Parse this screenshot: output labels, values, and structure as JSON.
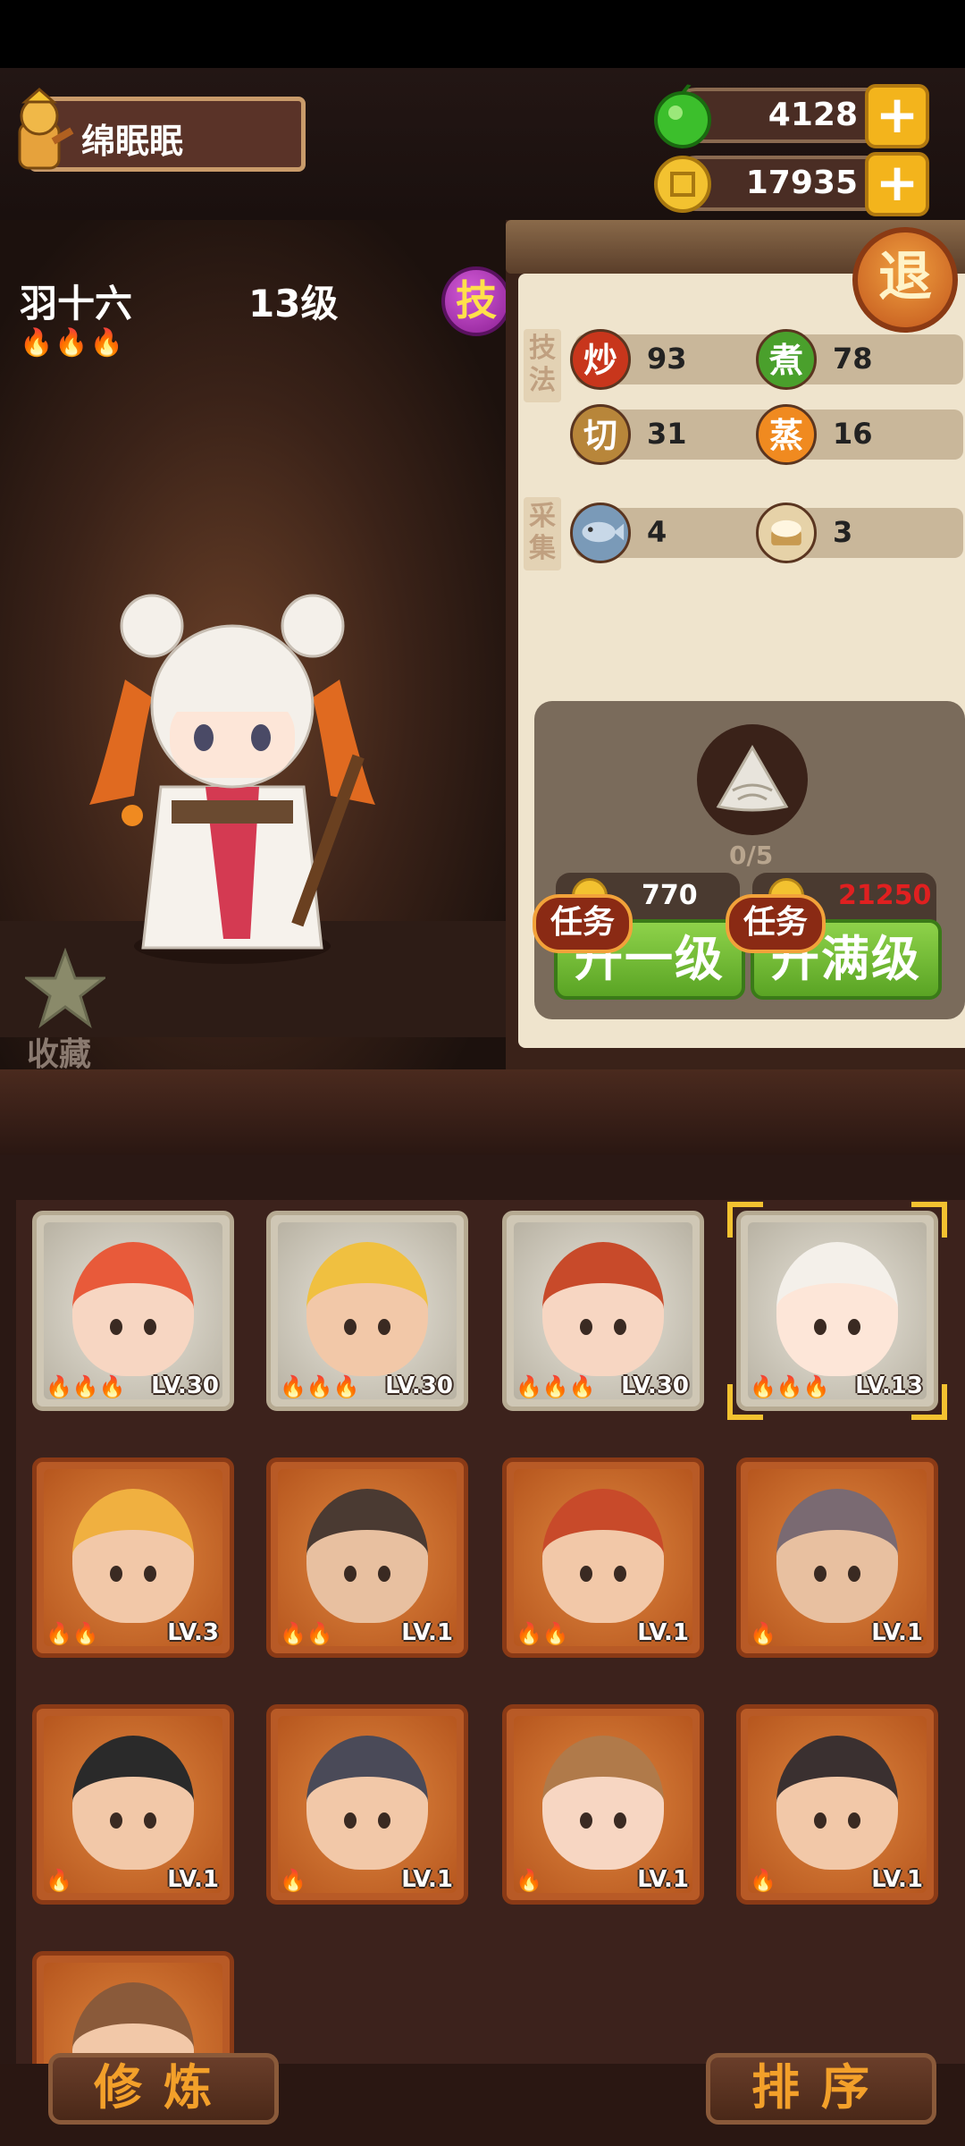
{
  "player": {
    "name": "绵眠眠"
  },
  "resources": {
    "jade": "4128",
    "coins": "17935"
  },
  "character": {
    "name": "羽十六",
    "level": "13级",
    "flames": "🔥🔥🔥",
    "skill_button": "技",
    "favorite_label": "收藏"
  },
  "exit_button": "退",
  "stats": {
    "technique_tag": "技法",
    "gather_tag": "采集",
    "stir_fry": {
      "label": "炒",
      "value": "93"
    },
    "boil": {
      "label": "煮",
      "value": "78"
    },
    "cut": {
      "label": "切",
      "value": "31"
    },
    "steam": {
      "label": "蒸",
      "value": "16"
    },
    "fish": {
      "value": "4"
    },
    "bun": {
      "value": "3"
    }
  },
  "upgrade": {
    "progress": "0/5",
    "one_level_cost": "770",
    "max_level_cost": "21250",
    "one_level_label": "升一级",
    "max_level_label": "升满级",
    "task_tag": "任务"
  },
  "roster": [
    {
      "level": "LV.30",
      "flames": "🔥🔥🔥",
      "frame": "gold"
    },
    {
      "level": "LV.30",
      "flames": "🔥🔥🔥",
      "frame": "gold"
    },
    {
      "level": "LV.30",
      "flames": "🔥🔥🔥",
      "frame": "gold"
    },
    {
      "level": "LV.13",
      "flames": "🔥🔥🔥",
      "frame": "gold",
      "selected": true
    },
    {
      "level": "LV.3",
      "flames": "🔥🔥",
      "frame": "copper"
    },
    {
      "level": "LV.1",
      "flames": "🔥🔥",
      "frame": "copper"
    },
    {
      "level": "LV.1",
      "flames": "🔥🔥",
      "frame": "copper"
    },
    {
      "level": "LV.1",
      "flames": "🔥",
      "frame": "copper"
    },
    {
      "level": "LV.1",
      "flames": "🔥",
      "frame": "copper"
    },
    {
      "level": "LV.1",
      "flames": "🔥",
      "frame": "copper"
    },
    {
      "level": "LV.1",
      "flames": "🔥",
      "frame": "copper"
    },
    {
      "level": "LV.1",
      "flames": "🔥",
      "frame": "copper"
    },
    {
      "level": "",
      "flames": "",
      "frame": "copper"
    }
  ],
  "buttons": {
    "train": "修炼",
    "sort": "排序"
  },
  "colors": {
    "accent_gold": "#f3b41c",
    "upgrade_green": "#6fbe32",
    "max_cost_red": "#e02020"
  }
}
